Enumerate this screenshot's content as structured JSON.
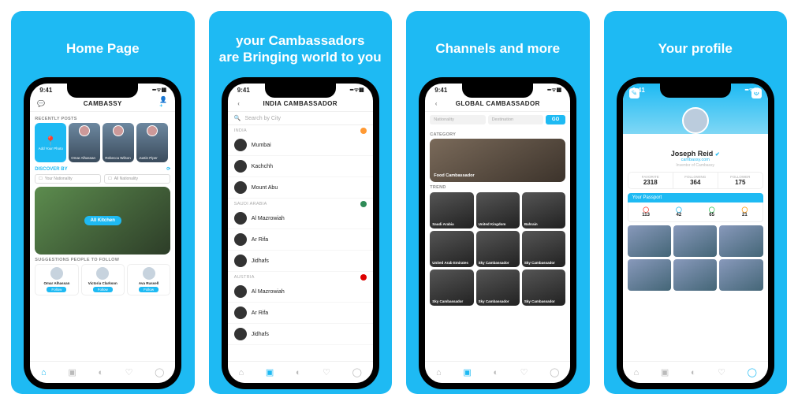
{
  "status_time": "9:41",
  "panels": [
    {
      "title": "Home Page"
    },
    {
      "title": "your Cambassadors\nare Bringing world to you"
    },
    {
      "title": "Channels and more"
    },
    {
      "title": "Your profile"
    }
  ],
  "screen1": {
    "app_title": "CAMBASSY",
    "section_recent": "RECENTLY POSTS",
    "add_photo": "Add Your Photo",
    "stories": [
      "Omar Alhassan",
      "Rebecca Wilson",
      "Justin Piper"
    ],
    "discover_label": "DISCOVER BY",
    "filter_nationality": "Your Nationality",
    "filter_all": "All Nationality",
    "big_card_label": "All Kitchen",
    "suggestions_label": "SUGGESTIONS PEOPLE TO FOLLOW",
    "suggestions": [
      {
        "name": "Omar Alhassan",
        "btn": "Follow"
      },
      {
        "name": "Victoria Clarkson",
        "btn": "Follow"
      },
      {
        "name": "Ava Russell",
        "btn": "Follow"
      }
    ]
  },
  "screen2": {
    "app_title": "INDIA CAMBASSADOR",
    "search_placeholder": "Search by City",
    "groups": [
      {
        "header": "INDIA",
        "flag": "#ff9933",
        "items": [
          "Mumbai",
          "Kachchh",
          "Mount Abu"
        ]
      },
      {
        "header": "SAUDI ARABIA",
        "flag": "#2e8b57",
        "items": [
          "Al Mazrowiah",
          "Ar Rifa",
          "Jidhafs"
        ]
      },
      {
        "header": "Austria",
        "flag": "#d00",
        "items": [
          "Al Mazrowiah",
          "Ar Rifa",
          "Jidhafs"
        ]
      }
    ]
  },
  "screen3": {
    "app_title": "GLOBAL CAMBASSADOR",
    "chip1": "Nationality",
    "chip2": "Destination",
    "go": "GO",
    "category_label": "CATEGORY",
    "category_card": "Food Cambassador",
    "trend_label": "TREND",
    "trend": [
      "Saudi Arabia",
      "United Kingdom",
      "Bahrain",
      "United Arab Emirates",
      "Sky Cambassador",
      "Sky Cambassador",
      "Sky Cambassador",
      "Sky Cambassador",
      "Sky Cambassador"
    ]
  },
  "screen4": {
    "name": "Joseph Reid",
    "verified": "✔",
    "handle": "cambassy.com",
    "subtitle": "Inventor of Cambassy",
    "stats": [
      {
        "label": "FAVORITE",
        "value": "2318"
      },
      {
        "label": "FOLLOWING",
        "value": "364"
      },
      {
        "label": "FOLLOWER",
        "value": "175"
      }
    ],
    "passport_label": "Your Passport",
    "passport_counts": [
      {
        "value": "113",
        "color": "#ff3b30"
      },
      {
        "value": "42",
        "color": "#1ebaf3"
      },
      {
        "value": "65",
        "color": "#34c759"
      },
      {
        "value": "21",
        "color": "#ff9500"
      }
    ]
  }
}
